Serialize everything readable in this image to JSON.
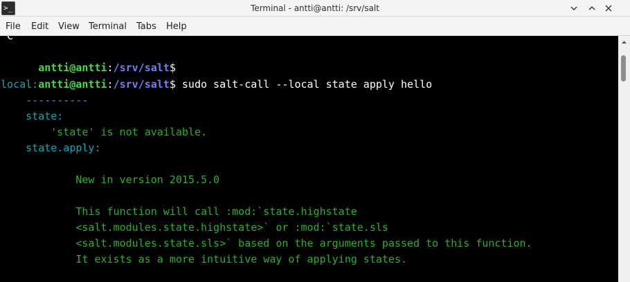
{
  "window": {
    "title": "Terminal - antti@antti: /srv/salt",
    "icon_glyph": ">_",
    "buttons": {
      "minimize": "minimize-icon",
      "maximize": "maximize-icon",
      "close": "close-icon"
    }
  },
  "menu": {
    "items": [
      "File",
      "Edit",
      "View",
      "Terminal",
      "Tabs",
      "Help"
    ]
  },
  "terminal": {
    "prompt_user": "antti@antti",
    "prompt_sep": ":",
    "prompt_path": "/srv/salt",
    "prompt_symbol": "$",
    "lines": {
      "l0": "^C",
      "l2_cmd": " sudo salt-call --local state apply hello",
      "l3": "local:",
      "l4": "    ----------",
      "l5": "    state:",
      "l6": "        'state' is not available.",
      "l7": "    state.apply:",
      "l9": "            New in version 2015.5.0",
      "l11": "            This function will call :mod:`state.highstate",
      "l12": "            <salt.modules.state.highstate>` or :mod:`state.sls",
      "l13": "            <salt.modules.state.sls>` based on the arguments passed to this function.",
      "l14": "            It exists as a more intuitive way of applying states."
    }
  },
  "colors": {
    "user": "#48d848",
    "path": "#7a7af8",
    "key": "#17a5b5",
    "separator": "#3aa0d8",
    "value": "#2fae2f",
    "background": "#000000"
  }
}
